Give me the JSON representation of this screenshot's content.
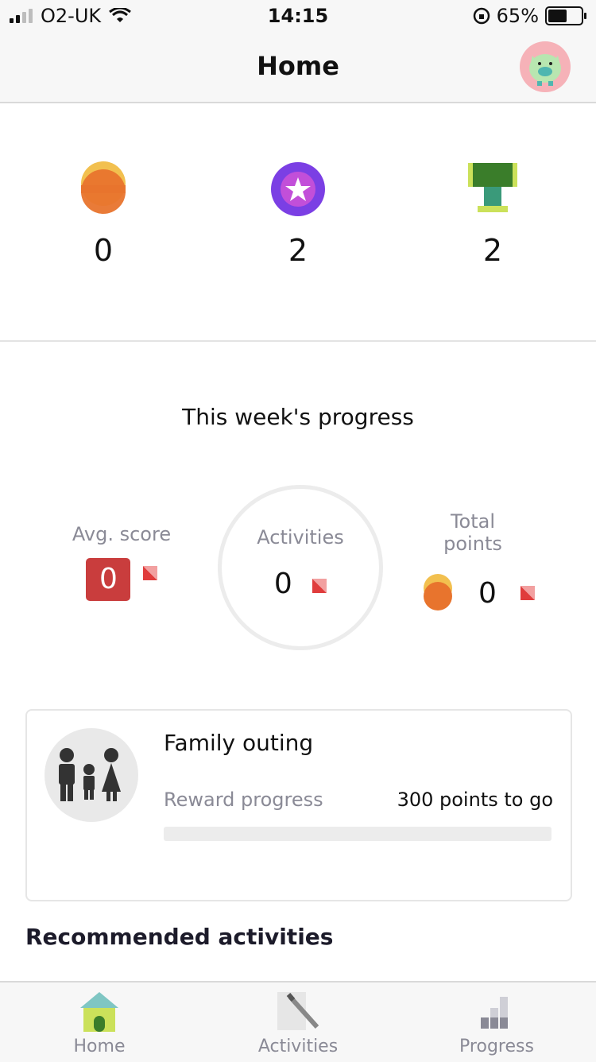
{
  "status_bar": {
    "carrier": "O2-UK",
    "time": "14:15",
    "battery_percent": "65%",
    "battery_level": 0.65
  },
  "nav": {
    "title": "Home",
    "avatar_icon": "pig-avatar-icon"
  },
  "stats": [
    {
      "icon": "coin-icon",
      "value": "0"
    },
    {
      "icon": "star-badge-icon",
      "value": "2"
    },
    {
      "icon": "trophy-icon",
      "value": "2"
    }
  ],
  "weekly": {
    "title": "This week's progress",
    "avg_label": "Avg. score",
    "avg_value": "0",
    "activities_label": "Activities",
    "activities_value": "0",
    "total_label": "Total points",
    "total_value": "0"
  },
  "reward": {
    "title": "Family outing",
    "progress_label": "Reward progress",
    "points_to_go": "300 points to go",
    "progress_fraction": 0.0
  },
  "recommended_title": "Recommended activities",
  "tabs": [
    {
      "label": "Home",
      "icon": "house-icon"
    },
    {
      "label": "Activities",
      "icon": "pencil-icon"
    },
    {
      "label": "Progress",
      "icon": "bar-chart-icon"
    }
  ],
  "colors": {
    "accent_red": "#c93d3d",
    "coin_orange": "#e8742d",
    "coin_yellow": "#f2c04f",
    "badge_purple": "#7b3fe4",
    "trophy_green": "#3a7d2a"
  }
}
